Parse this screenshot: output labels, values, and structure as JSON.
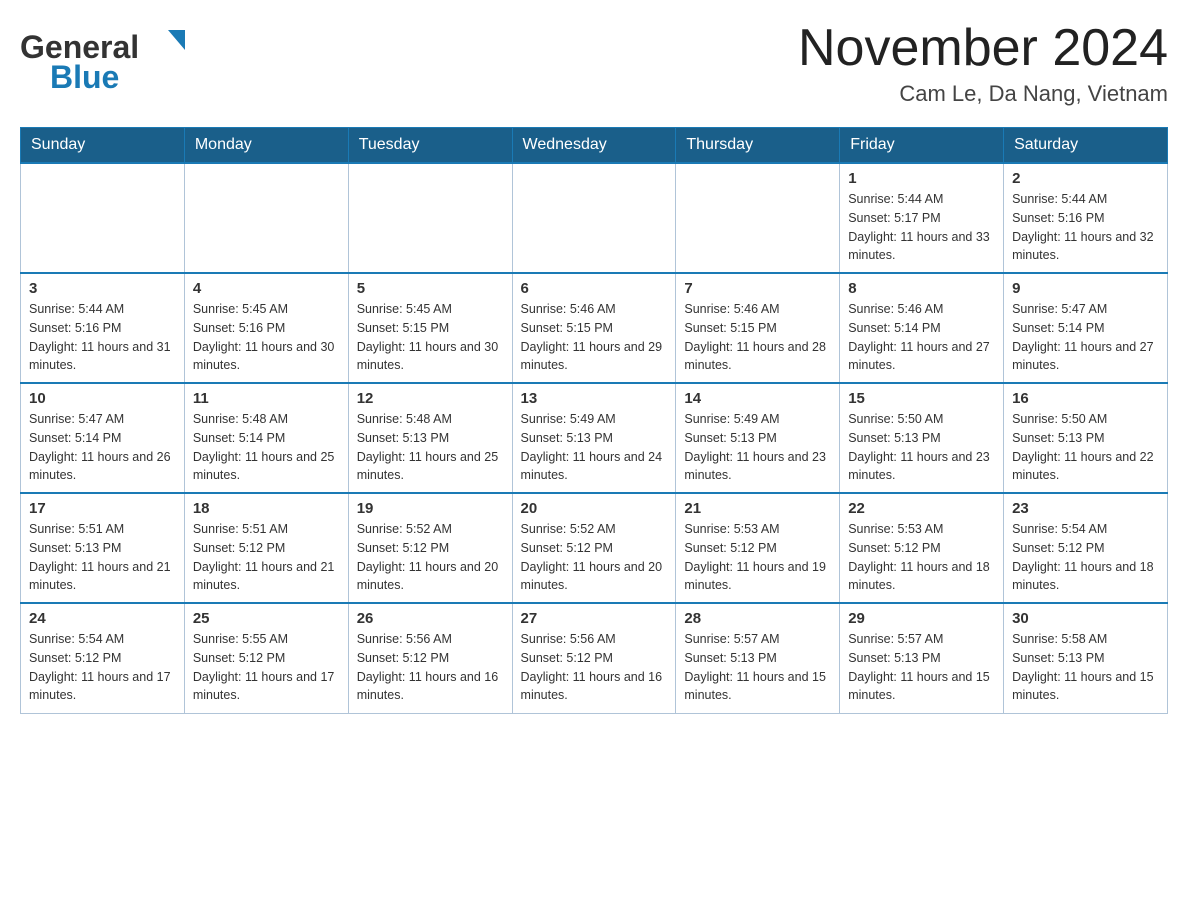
{
  "header": {
    "logo_general": "General",
    "logo_blue": "Blue",
    "month_title": "November 2024",
    "location": "Cam Le, Da Nang, Vietnam"
  },
  "weekdays": [
    "Sunday",
    "Monday",
    "Tuesday",
    "Wednesday",
    "Thursday",
    "Friday",
    "Saturday"
  ],
  "weeks": [
    [
      {
        "day": "",
        "info": ""
      },
      {
        "day": "",
        "info": ""
      },
      {
        "day": "",
        "info": ""
      },
      {
        "day": "",
        "info": ""
      },
      {
        "day": "",
        "info": ""
      },
      {
        "day": "1",
        "info": "Sunrise: 5:44 AM\nSunset: 5:17 PM\nDaylight: 11 hours and 33 minutes."
      },
      {
        "day": "2",
        "info": "Sunrise: 5:44 AM\nSunset: 5:16 PM\nDaylight: 11 hours and 32 minutes."
      }
    ],
    [
      {
        "day": "3",
        "info": "Sunrise: 5:44 AM\nSunset: 5:16 PM\nDaylight: 11 hours and 31 minutes."
      },
      {
        "day": "4",
        "info": "Sunrise: 5:45 AM\nSunset: 5:16 PM\nDaylight: 11 hours and 30 minutes."
      },
      {
        "day": "5",
        "info": "Sunrise: 5:45 AM\nSunset: 5:15 PM\nDaylight: 11 hours and 30 minutes."
      },
      {
        "day": "6",
        "info": "Sunrise: 5:46 AM\nSunset: 5:15 PM\nDaylight: 11 hours and 29 minutes."
      },
      {
        "day": "7",
        "info": "Sunrise: 5:46 AM\nSunset: 5:15 PM\nDaylight: 11 hours and 28 minutes."
      },
      {
        "day": "8",
        "info": "Sunrise: 5:46 AM\nSunset: 5:14 PM\nDaylight: 11 hours and 27 minutes."
      },
      {
        "day": "9",
        "info": "Sunrise: 5:47 AM\nSunset: 5:14 PM\nDaylight: 11 hours and 27 minutes."
      }
    ],
    [
      {
        "day": "10",
        "info": "Sunrise: 5:47 AM\nSunset: 5:14 PM\nDaylight: 11 hours and 26 minutes."
      },
      {
        "day": "11",
        "info": "Sunrise: 5:48 AM\nSunset: 5:14 PM\nDaylight: 11 hours and 25 minutes."
      },
      {
        "day": "12",
        "info": "Sunrise: 5:48 AM\nSunset: 5:13 PM\nDaylight: 11 hours and 25 minutes."
      },
      {
        "day": "13",
        "info": "Sunrise: 5:49 AM\nSunset: 5:13 PM\nDaylight: 11 hours and 24 minutes."
      },
      {
        "day": "14",
        "info": "Sunrise: 5:49 AM\nSunset: 5:13 PM\nDaylight: 11 hours and 23 minutes."
      },
      {
        "day": "15",
        "info": "Sunrise: 5:50 AM\nSunset: 5:13 PM\nDaylight: 11 hours and 23 minutes."
      },
      {
        "day": "16",
        "info": "Sunrise: 5:50 AM\nSunset: 5:13 PM\nDaylight: 11 hours and 22 minutes."
      }
    ],
    [
      {
        "day": "17",
        "info": "Sunrise: 5:51 AM\nSunset: 5:13 PM\nDaylight: 11 hours and 21 minutes."
      },
      {
        "day": "18",
        "info": "Sunrise: 5:51 AM\nSunset: 5:12 PM\nDaylight: 11 hours and 21 minutes."
      },
      {
        "day": "19",
        "info": "Sunrise: 5:52 AM\nSunset: 5:12 PM\nDaylight: 11 hours and 20 minutes."
      },
      {
        "day": "20",
        "info": "Sunrise: 5:52 AM\nSunset: 5:12 PM\nDaylight: 11 hours and 20 minutes."
      },
      {
        "day": "21",
        "info": "Sunrise: 5:53 AM\nSunset: 5:12 PM\nDaylight: 11 hours and 19 minutes."
      },
      {
        "day": "22",
        "info": "Sunrise: 5:53 AM\nSunset: 5:12 PM\nDaylight: 11 hours and 18 minutes."
      },
      {
        "day": "23",
        "info": "Sunrise: 5:54 AM\nSunset: 5:12 PM\nDaylight: 11 hours and 18 minutes."
      }
    ],
    [
      {
        "day": "24",
        "info": "Sunrise: 5:54 AM\nSunset: 5:12 PM\nDaylight: 11 hours and 17 minutes."
      },
      {
        "day": "25",
        "info": "Sunrise: 5:55 AM\nSunset: 5:12 PM\nDaylight: 11 hours and 17 minutes."
      },
      {
        "day": "26",
        "info": "Sunrise: 5:56 AM\nSunset: 5:12 PM\nDaylight: 11 hours and 16 minutes."
      },
      {
        "day": "27",
        "info": "Sunrise: 5:56 AM\nSunset: 5:12 PM\nDaylight: 11 hours and 16 minutes."
      },
      {
        "day": "28",
        "info": "Sunrise: 5:57 AM\nSunset: 5:13 PM\nDaylight: 11 hours and 15 minutes."
      },
      {
        "day": "29",
        "info": "Sunrise: 5:57 AM\nSunset: 5:13 PM\nDaylight: 11 hours and 15 minutes."
      },
      {
        "day": "30",
        "info": "Sunrise: 5:58 AM\nSunset: 5:13 PM\nDaylight: 11 hours and 15 minutes."
      }
    ]
  ]
}
